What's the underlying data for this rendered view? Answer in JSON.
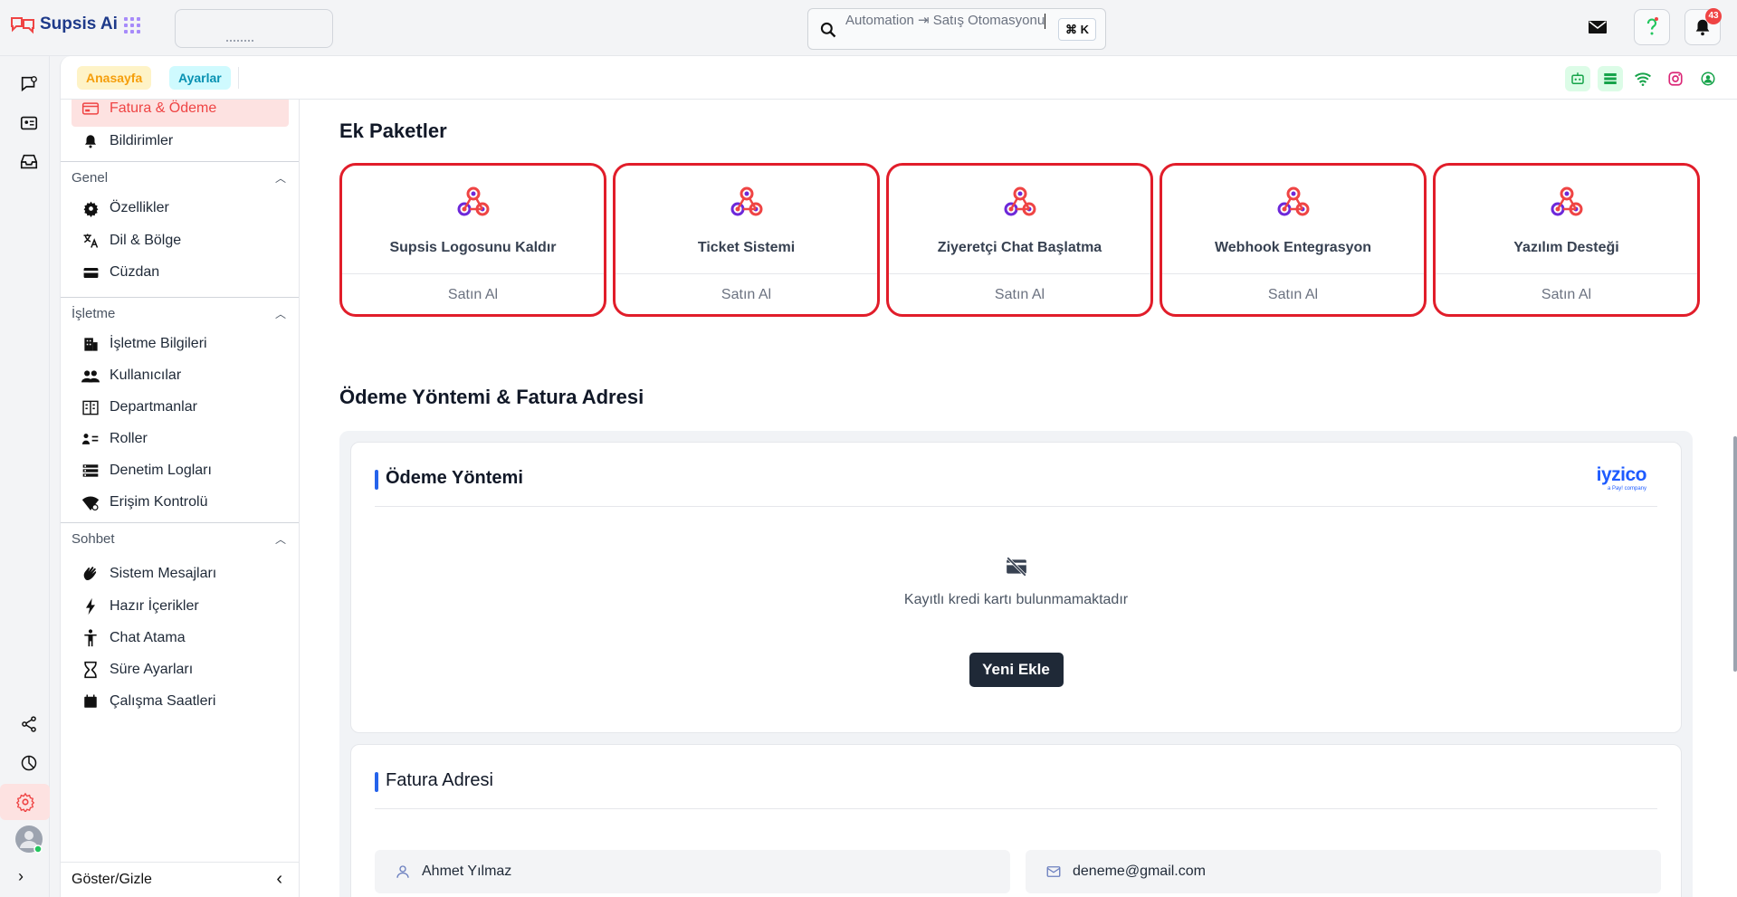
{
  "app": {
    "name": "Supsis Ai"
  },
  "search": {
    "text": "Automation ⇥ Satış Otomasyonu",
    "shortcut": "⌘ K"
  },
  "notifications": {
    "count": "43"
  },
  "breadcrumbs": {
    "home": "Anasayfa",
    "settings": "Ayarlar"
  },
  "sidebar": {
    "top_items": [
      {
        "label": "Fatura & Ödeme",
        "icon": "billing-icon",
        "active": true
      },
      {
        "label": "Bildirimler",
        "icon": "bell-icon"
      }
    ],
    "sections": [
      {
        "title": "Genel",
        "items": [
          {
            "label": "Özellikler",
            "icon": "gear-icon"
          },
          {
            "label": "Dil & Bölge",
            "icon": "translate-icon"
          },
          {
            "label": "Cüzdan",
            "icon": "wallet-icon"
          }
        ]
      },
      {
        "title": "İşletme",
        "items": [
          {
            "label": "İşletme Bilgileri",
            "icon": "building-icon"
          },
          {
            "label": "Kullanıcılar",
            "icon": "users-icon"
          },
          {
            "label": "Departmanlar",
            "icon": "departments-icon"
          },
          {
            "label": "Roller",
            "icon": "roles-icon"
          },
          {
            "label": "Denetim Logları",
            "icon": "logs-icon"
          },
          {
            "label": "Erişim Kontrolü",
            "icon": "access-control-icon"
          }
        ]
      },
      {
        "title": "Sohbet",
        "items": [
          {
            "label": "Sistem Mesajları",
            "icon": "waving-hand-icon"
          },
          {
            "label": "Hazır İçerikler",
            "icon": "bolt-icon"
          },
          {
            "label": "Chat Atama",
            "icon": "person-icon"
          },
          {
            "label": "Süre Ayarları",
            "icon": "hourglass-icon"
          },
          {
            "label": "Çalışma Saatleri",
            "icon": "calendar-icon"
          }
        ]
      }
    ],
    "footer_label": "Göster/Gizle"
  },
  "ek_paketler": {
    "title": "Ek Paketler",
    "buy_label": "Satın Al",
    "packages": [
      {
        "title": "Supsis Logosunu Kaldır"
      },
      {
        "title": "Ticket Sistemi"
      },
      {
        "title": "Ziyeretçi Chat Başlatma"
      },
      {
        "title": "Webhook Entegrasyon"
      },
      {
        "title": "Yazılım Desteği"
      }
    ]
  },
  "payment": {
    "section_title": "Ödeme Yöntemi & Fatura Adresi",
    "method_title": "Ödeme Yöntemi",
    "provider": "iyzico",
    "provider_sub": "a Pay! company",
    "empty_text": "Kayıtlı kredi kartı bulunmamaktadır",
    "add_button": "Yeni Ekle",
    "address_title": "Fatura Adresi",
    "name_value": "Ahmet Yılmaz",
    "email_value": "deneme@gmail.com"
  },
  "colors": {
    "accent": "#ef4444",
    "highlight_border": "#e11d2a",
    "primary_blue": "#2563eb",
    "dark_button": "#1f2937"
  }
}
